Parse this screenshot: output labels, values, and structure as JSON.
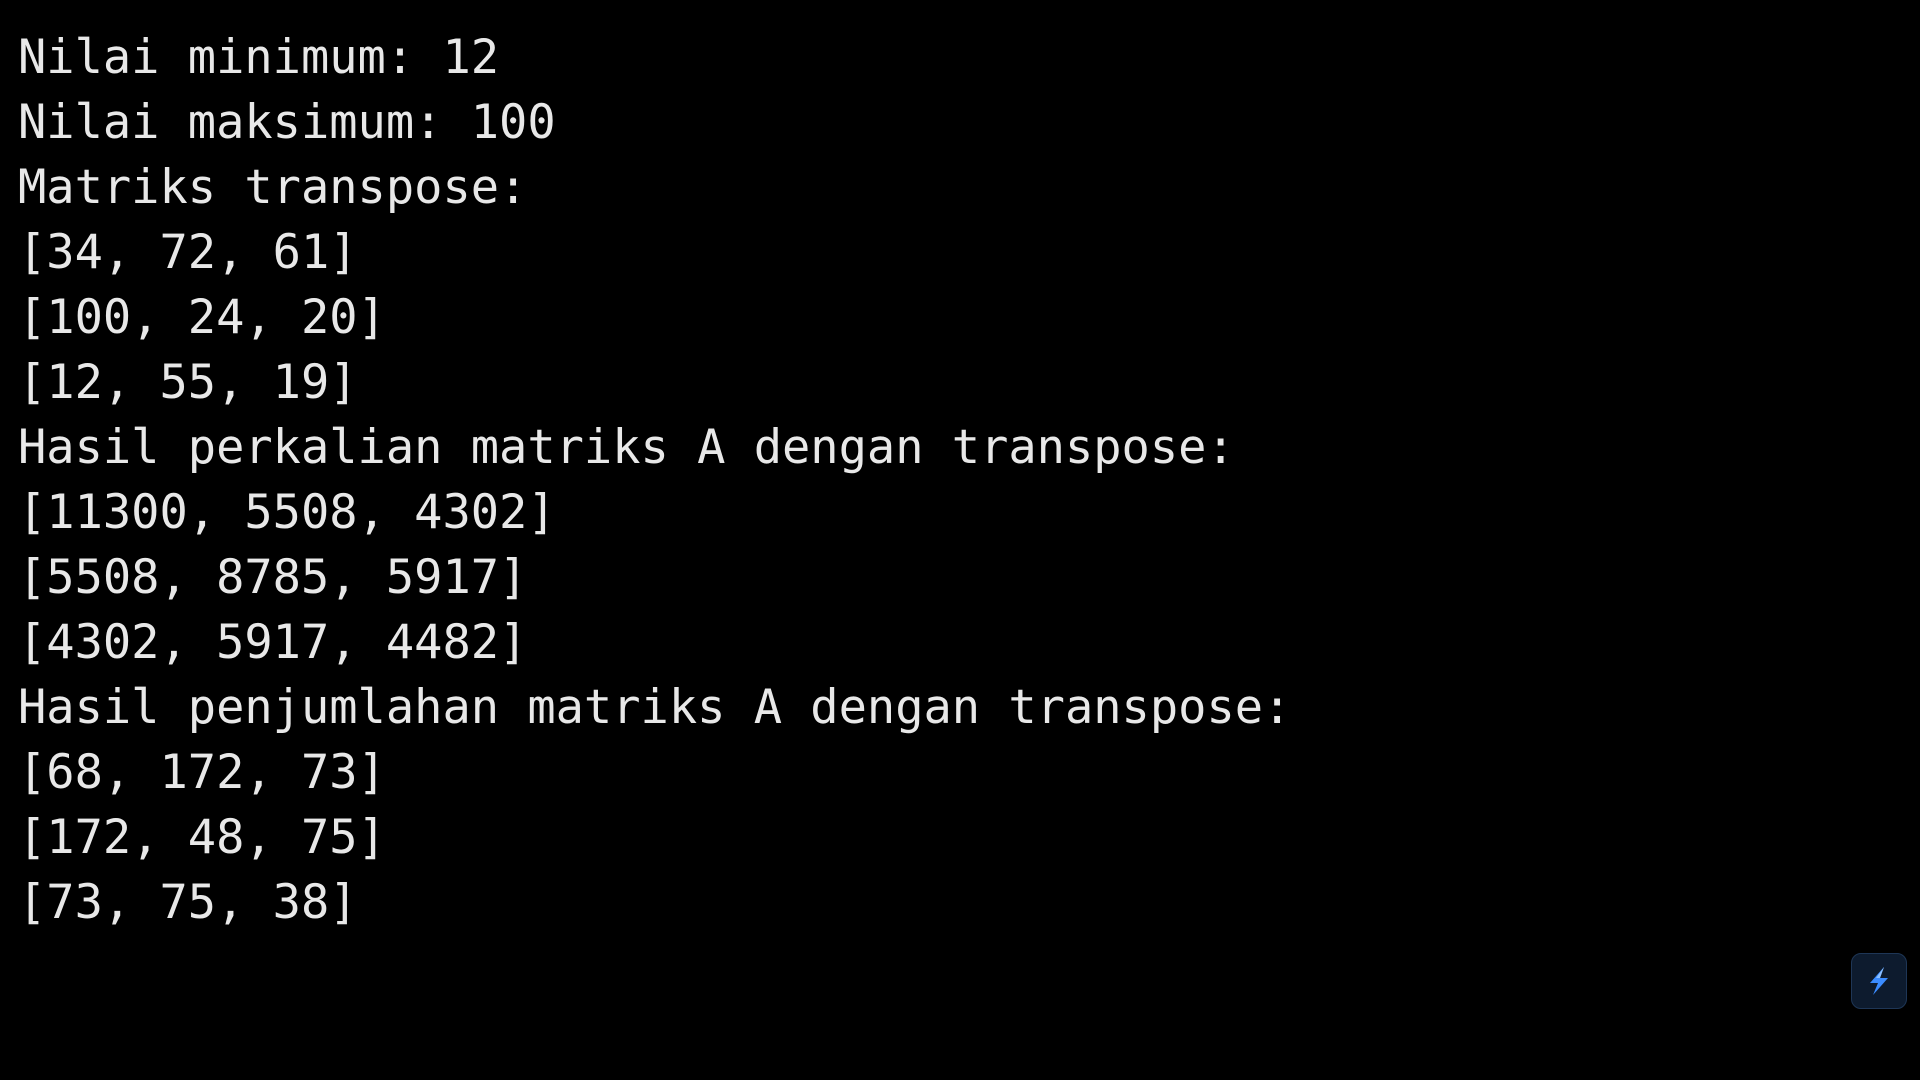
{
  "terminal": {
    "lines": [
      "Nilai minimum: 12",
      "Nilai maksimum: 100",
      "Matriks transpose:",
      "[34, 72, 61]",
      "[100, 24, 20]",
      "[12, 55, 19]",
      "Hasil perkalian matriks A dengan transpose:",
      "[11300, 5508, 4302]",
      "[5508, 8785, 5917]",
      "[4302, 5917, 4482]",
      "Hasil penjumlahan matriks A dengan transpose:",
      "[68, 172, 73]",
      "[172, 48, 75]",
      "[73, 75, 38]"
    ]
  },
  "colors": {
    "background": "#000000",
    "text": "#e8e8e8",
    "accent": "#3b8cff"
  },
  "widget": {
    "icon": "lightning-bolt-icon"
  }
}
